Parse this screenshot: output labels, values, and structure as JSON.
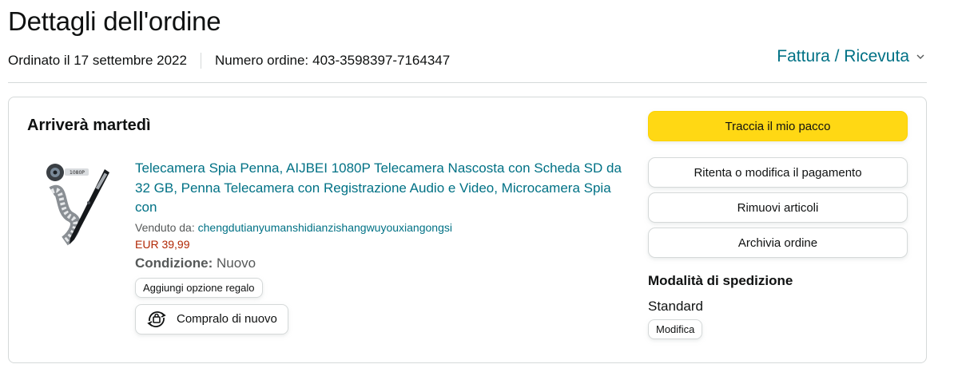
{
  "header": {
    "title": "Dettagli dell'ordine",
    "ordered_on": "Ordinato il 17 settembre 2022",
    "order_number_label": "Numero ordine:",
    "order_number": "403-3598397-7164347",
    "invoice_link": "Fattura / Ricevuta",
    "invoice_icon": "chevron-down-icon"
  },
  "shipment": {
    "status": "Arriverà martedì",
    "product": {
      "image_icon": "spy-camera-pen-image",
      "title": "Telecamera Spia Penna, AIJBEI 1080P Telecamera Nascosta con Scheda SD da 32 GB, Penna Telecamera con Registrazione Audio e Video, Microcamera Spia con",
      "sold_by_label": "Venduto da:",
      "seller": "chengdutianyumanshidianzishangwuyouxiangongsi",
      "price": "EUR 39,99",
      "condition_label": "Condizione:",
      "condition_value": "Nuovo",
      "gift_option_button": "Aggiungi opzione regalo",
      "buy_again_button": "Compralo di nuovo",
      "buy_again_icon": "buy-again-icon"
    }
  },
  "actions": {
    "track": "Traccia il mio pacco",
    "retry_payment": "Ritenta o modifica il pagamento",
    "remove_items": "Rimuovi articoli",
    "archive": "Archivia ordine"
  },
  "shipping": {
    "heading": "Modalità di spedizione",
    "value": "Standard",
    "edit_button": "Modifica"
  },
  "colors": {
    "link": "#007185",
    "price": "#b12704",
    "primary_button": "#ffd814",
    "border": "#d5d9d9",
    "text": "#0f1111"
  }
}
